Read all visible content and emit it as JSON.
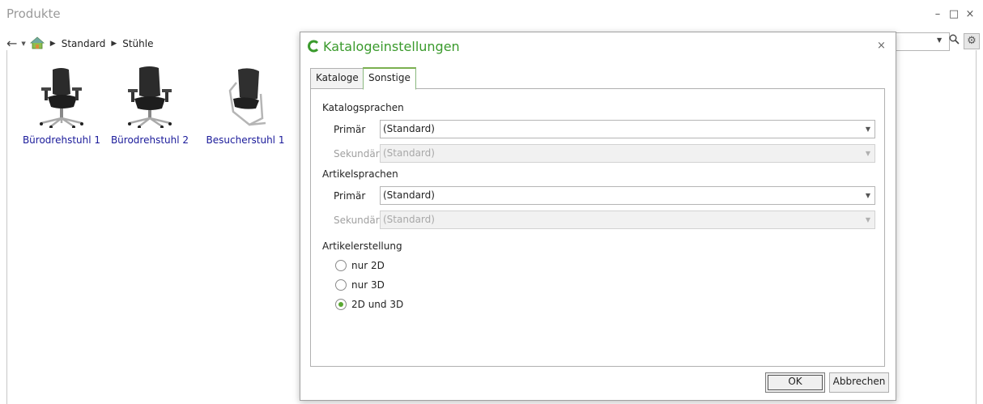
{
  "window": {
    "title": "Produkte",
    "controls": {
      "minimize": "–",
      "maximize": "□",
      "close": "×"
    }
  },
  "toolbar": {
    "back_icon": "arrow-left-icon",
    "home_icon": "home-icon",
    "breadcrumb": [
      "Standard",
      "Stühle"
    ]
  },
  "products": [
    {
      "label": "Bürodrehstuhl 1",
      "icon": "office-chair-image"
    },
    {
      "label": "Bürodrehstuhl 2",
      "icon": "office-chair-image"
    },
    {
      "label": "Besucherstuhl 1",
      "icon": "visitor-chair-image"
    }
  ],
  "search": {
    "value": "",
    "icon": "search-icon"
  },
  "dialog": {
    "title": "Katalogeinstellungen",
    "close": "×",
    "tabs": [
      {
        "label": "Kataloge",
        "active": false
      },
      {
        "label": "Sonstige",
        "active": true
      }
    ],
    "catalog_languages": {
      "heading": "Katalogsprachen",
      "primary_label": "Primär",
      "primary_value": "(Standard)",
      "secondary_label": "Sekundär",
      "secondary_value": "(Standard)"
    },
    "article_languages": {
      "heading": "Artikelsprachen",
      "primary_label": "Primär",
      "primary_value": "(Standard)",
      "secondary_label": "Sekundär",
      "secondary_value": "(Standard)"
    },
    "article_creation": {
      "heading": "Artikelerstellung",
      "options": [
        {
          "label": "nur 2D",
          "checked": false
        },
        {
          "label": "nur 3D",
          "checked": false
        },
        {
          "label": "2D und 3D",
          "checked": true
        }
      ]
    },
    "buttons": {
      "ok": "OK",
      "cancel": "Abbrechen"
    }
  },
  "colors": {
    "accent": "#3a9a2c",
    "link": "#1a1a9a"
  }
}
